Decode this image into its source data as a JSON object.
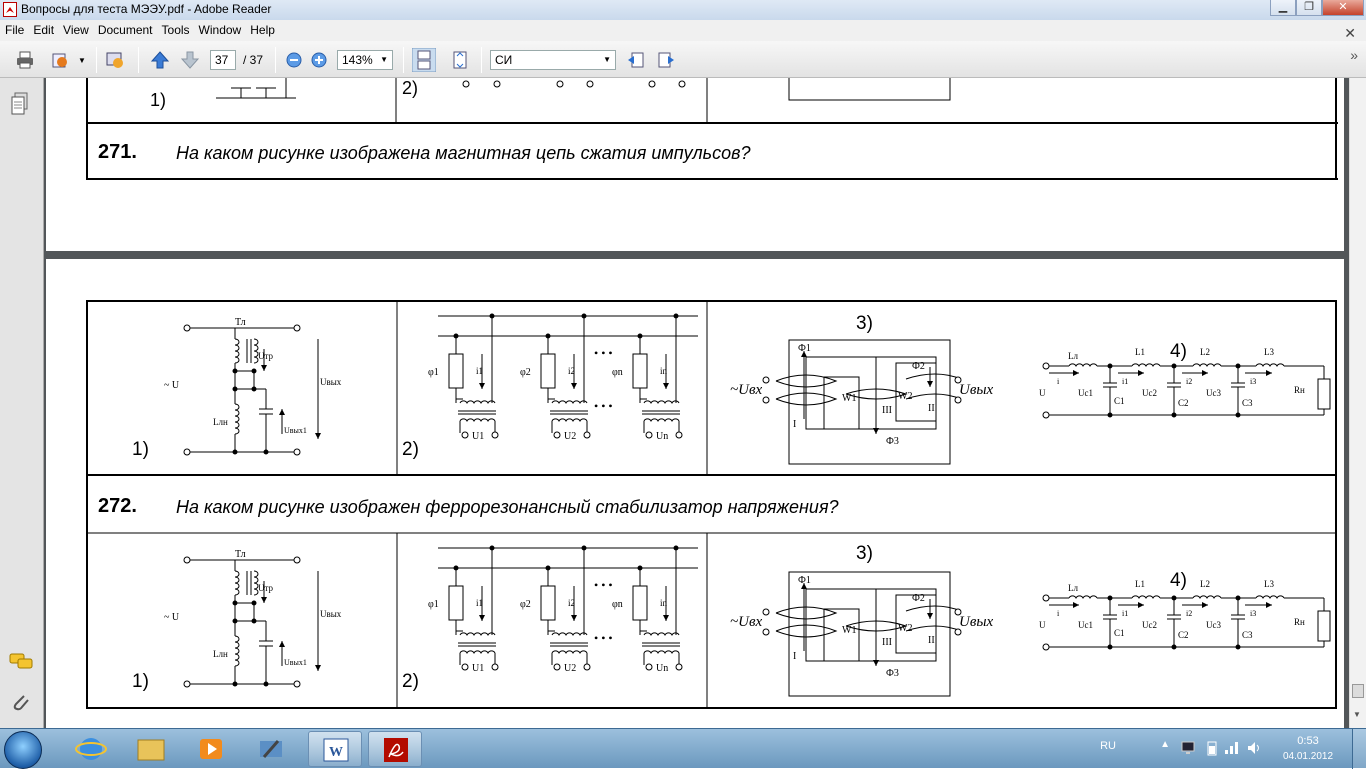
{
  "window": {
    "title": "Вопросы для теста МЭЭУ.pdf - Adobe Reader"
  },
  "menu": [
    "File",
    "Edit",
    "View",
    "Document",
    "Tools",
    "Window",
    "Help"
  ],
  "toolbar": {
    "page_current": "37",
    "page_total": "/ 37",
    "zoom": "143%",
    "find_text": "СИ"
  },
  "page_top": {
    "q_number": "271.",
    "q_text": "На каком рисунке изображена магнитная цепь сжатия импульсов?",
    "labels": [
      "1)",
      "2)"
    ]
  },
  "question": {
    "number": "272.",
    "text": "На каком рисунке изображен феррорезонансный стабилизатор напряжения?"
  },
  "figure_labels": {
    "f1": "1)",
    "f2": "2)",
    "f3": "3)",
    "f4": "4)"
  },
  "fig1": {
    "t": "Тл",
    "utr": "Uтр",
    "src": "~ U",
    "uvyh": "Uвых",
    "lln": "Lлн",
    "uvyh1": "Uвых1"
  },
  "fig2": {
    "phi1": "φ1",
    "phi2": "φ2",
    "phin": "φn",
    "i1": "i1",
    "i2": "i2",
    "in": "in",
    "u1": "U1",
    "u2": "U2",
    "un": "Un"
  },
  "fig3": {
    "f1": "Ф1",
    "f2": "Ф2",
    "f3": "Ф3",
    "uin": "~Uвх",
    "uout": "Uвых",
    "w1": "W1",
    "w2": "W2",
    "r1": "I",
    "r2": "II",
    "r3": "III"
  },
  "fig4": {
    "ll": "Lл",
    "l1": "L1",
    "l2": "L2",
    "l3": "L3",
    "u": "U",
    "i": "i",
    "i1": "i1",
    "i2": "i2",
    "i3": "i3",
    "uc1": "Uc1",
    "uc2": "Uc2",
    "uc3": "Uc3",
    "c1": "C1",
    "c2": "C2",
    "c3": "C3",
    "rn": "Rн"
  },
  "tray": {
    "lang": "RU",
    "time": "0:53",
    "date": "04.01.2012"
  }
}
